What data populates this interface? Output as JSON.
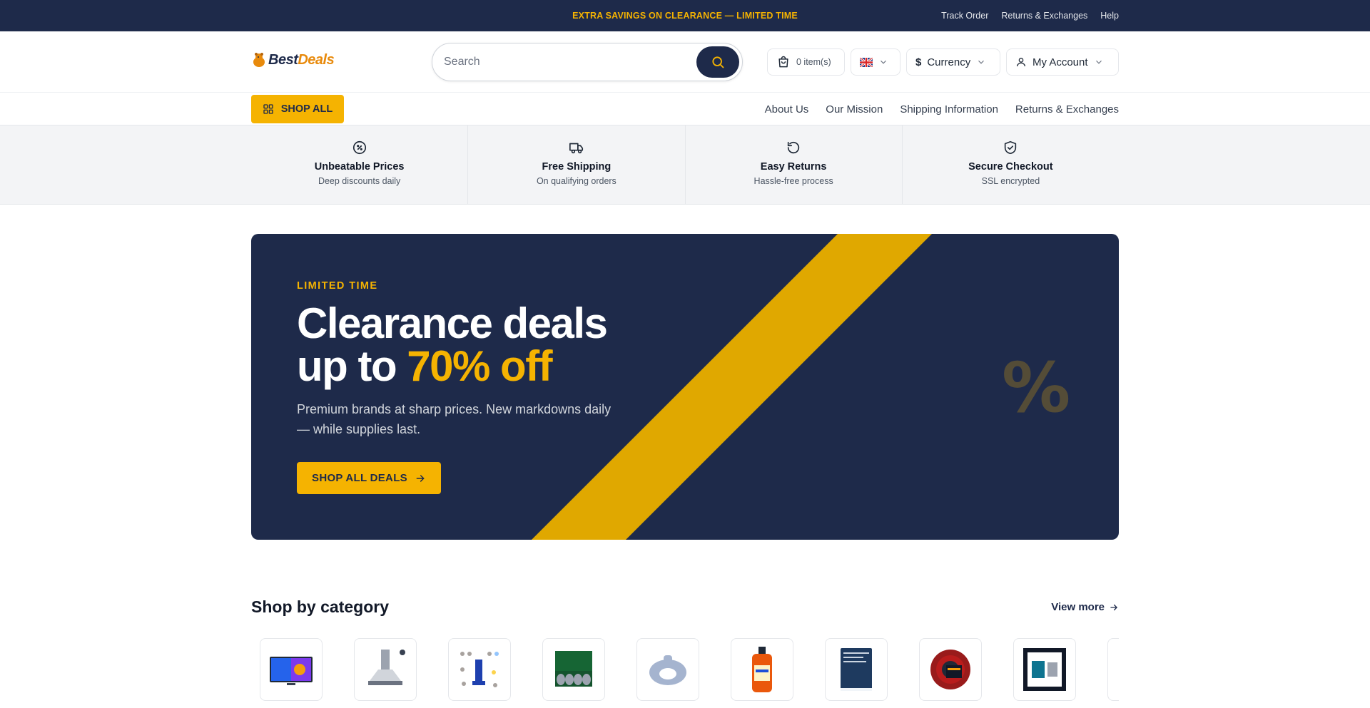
{
  "topbar": {
    "promo": "EXTRA SAVINGS ON CLEARANCE — LIMITED TIME",
    "links": [
      "Track Order",
      "Returns & Exchanges",
      "Help"
    ]
  },
  "header": {
    "logo_best": "Best",
    "logo_deals": "Deals",
    "search_placeholder": "Search",
    "cart_label": "0 item(s)",
    "currency_label": "Currency",
    "account_label": "My Account",
    "icons": {
      "search": "search-icon",
      "cart": "shopping-bag-icon",
      "flag": "uk-flag-icon",
      "currency": "dollar-icon",
      "account": "user-icon"
    }
  },
  "nav": {
    "shop_all": "SHOP ALL",
    "links": [
      "About Us",
      "Our Mission",
      "Shipping Information",
      "Returns & Exchanges"
    ]
  },
  "features": [
    {
      "title": "Unbeatable Prices",
      "sub": "Deep discounts daily",
      "icon": "percent-badge-icon"
    },
    {
      "title": "Free Shipping",
      "sub": "On qualifying orders",
      "icon": "truck-icon"
    },
    {
      "title": "Easy Returns",
      "sub": "Hassle-free process",
      "icon": "rotate-ccw-icon"
    },
    {
      "title": "Secure Checkout",
      "sub": "SSL encrypted",
      "icon": "shield-check-icon"
    }
  ],
  "hero": {
    "eyebrow": "LIMITED TIME",
    "title_line1": "Clearance deals",
    "title_line2_prefix": "up to ",
    "title_highlight": "70% off",
    "subtitle": "Premium brands at sharp prices. New markdowns daily — while supplies last.",
    "cta": "SHOP ALL DEALS",
    "decor": "%",
    "colors": {
      "navy": "#1e2a4a",
      "accent": "#f5b301",
      "stripe": "#e0a800"
    }
  },
  "categories": {
    "title": "Shop by category",
    "view_more": "View more",
    "items": [
      {
        "name": "category-tv",
        "icon": "tv-icon"
      },
      {
        "name": "category-range-hood",
        "icon": "range-hood-icon"
      },
      {
        "name": "category-tools",
        "icon": "tools-icon"
      },
      {
        "name": "category-automotive",
        "icon": "engine-parts-icon"
      },
      {
        "name": "category-baby",
        "icon": "potty-seat-icon"
      },
      {
        "name": "category-cleaning",
        "icon": "bottle-icon"
      },
      {
        "name": "category-books",
        "icon": "book-icon"
      },
      {
        "name": "category-garden",
        "icon": "hose-icon"
      },
      {
        "name": "category-art",
        "icon": "frame-icon"
      },
      {
        "name": "category-more",
        "icon": "partial-item-icon"
      }
    ]
  }
}
